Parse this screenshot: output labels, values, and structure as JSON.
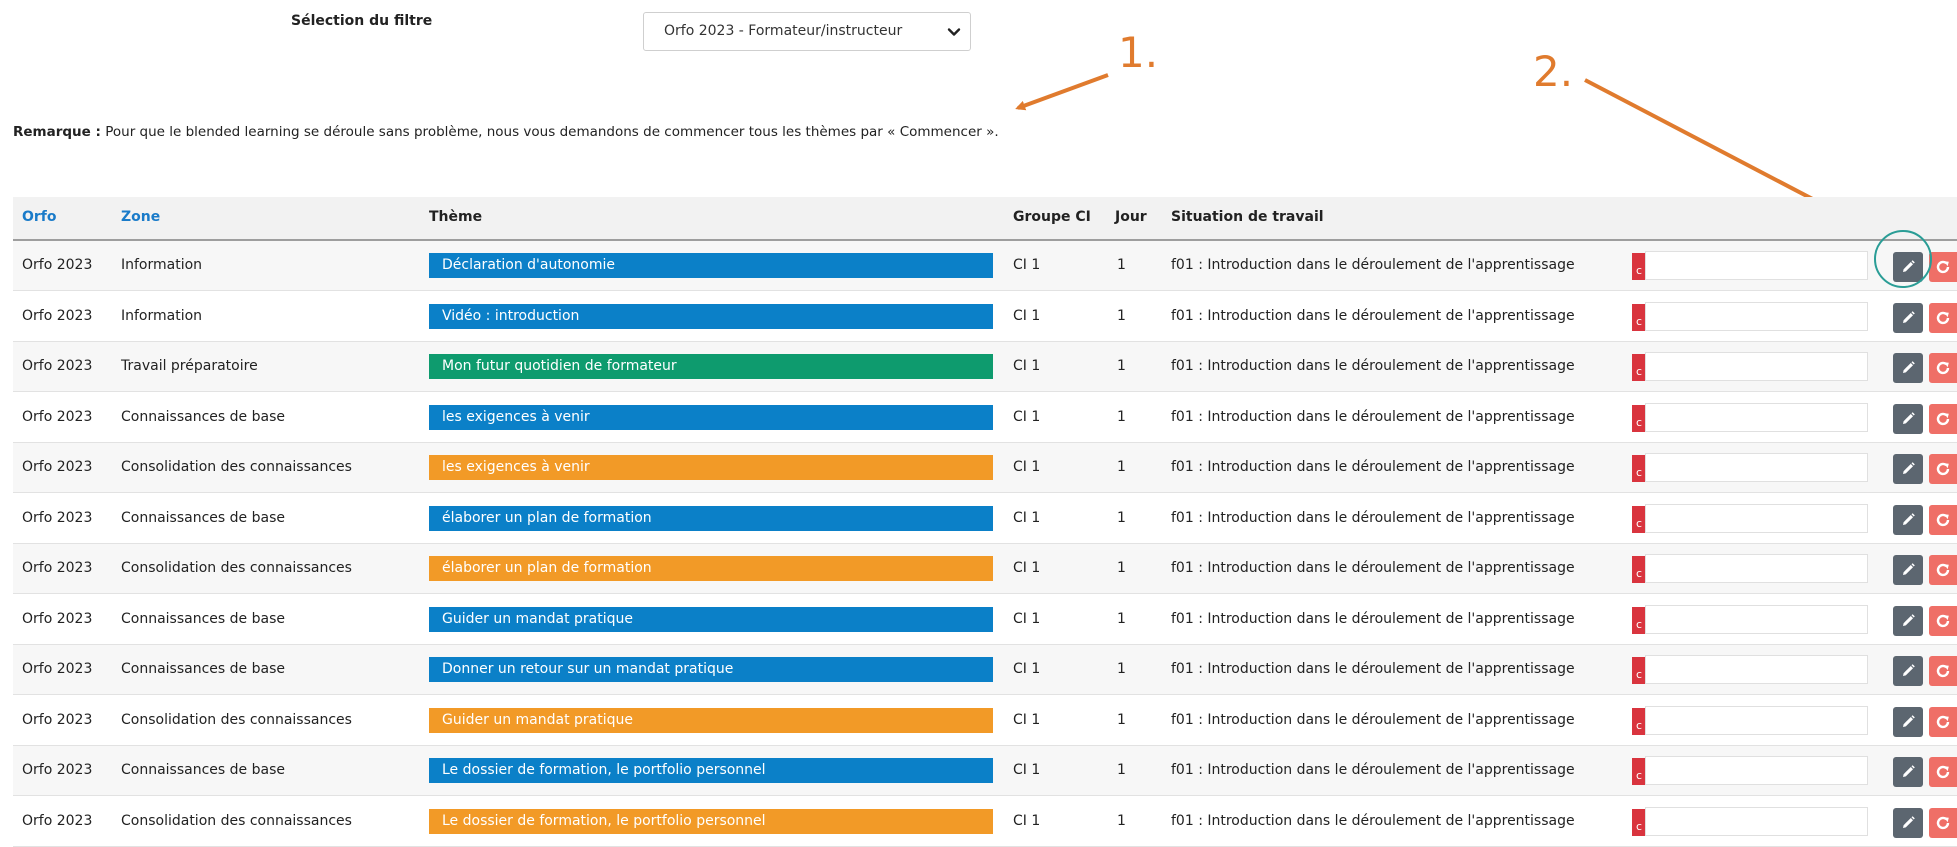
{
  "filter": {
    "label": "Sélection du filtre",
    "selected": "Orfo 2023 - Formateur/instructeur"
  },
  "annotations": {
    "one": "1.",
    "two": "2."
  },
  "remark": {
    "bold": "Remarque :",
    "text": " Pour que le blended learning se déroule sans problème, nous vous demandons de commencer tous les thèmes par « Commencer »."
  },
  "table": {
    "headers": {
      "orfo": "Orfo",
      "zone": "Zone",
      "theme": "Thème",
      "groupe": "Groupe CI",
      "jour": "Jour",
      "situation": "Situation de travail"
    },
    "rows": [
      {
        "orfo": "Orfo 2023",
        "zone": "Information",
        "theme": "Déclaration d'autonomie",
        "color": "#0b80c8",
        "groupe": "CI 1",
        "jour": "1",
        "situation": "f01 : Introduction dans le déroulement de l'apprentissage",
        "strip": "c"
      },
      {
        "orfo": "Orfo 2023",
        "zone": "Information",
        "theme": "Vidéo : introduction",
        "color": "#0b80c8",
        "groupe": "CI 1",
        "jour": "1",
        "situation": "f01 : Introduction dans le déroulement de l'apprentissage",
        "strip": "c"
      },
      {
        "orfo": "Orfo 2023",
        "zone": "Travail préparatoire",
        "theme": "Mon futur quotidien de formateur",
        "color": "#0e9b6e",
        "groupe": "CI 1",
        "jour": "1",
        "situation": "f01 : Introduction dans le déroulement de l'apprentissage",
        "strip": "c"
      },
      {
        "orfo": "Orfo 2023",
        "zone": "Connaissances de base",
        "theme": "les exigences à venir",
        "color": "#0b80c8",
        "groupe": "CI 1",
        "jour": "1",
        "situation": "f01 : Introduction dans le déroulement de l'apprentissage",
        "strip": "c"
      },
      {
        "orfo": "Orfo 2023",
        "zone": "Consolidation des connaissances",
        "theme": "les exigences à venir",
        "color": "#f29a27",
        "groupe": "CI 1",
        "jour": "1",
        "situation": "f01 : Introduction dans le déroulement de l'apprentissage",
        "strip": "c"
      },
      {
        "orfo": "Orfo 2023",
        "zone": "Connaissances de base",
        "theme": "élaborer un plan de formation",
        "color": "#0b80c8",
        "groupe": "CI 1",
        "jour": "1",
        "situation": "f01 : Introduction dans le déroulement de l'apprentissage",
        "strip": "c"
      },
      {
        "orfo": "Orfo 2023",
        "zone": "Consolidation des connaissances",
        "theme": "élaborer un plan de formation",
        "color": "#f29a27",
        "groupe": "CI 1",
        "jour": "1",
        "situation": "f01 : Introduction dans le déroulement de l'apprentissage",
        "strip": "c"
      },
      {
        "orfo": "Orfo 2023",
        "zone": "Connaissances de base",
        "theme": "Guider un mandat pratique",
        "color": "#0b80c8",
        "groupe": "CI 1",
        "jour": "1",
        "situation": "f01 : Introduction dans le déroulement de l'apprentissage",
        "strip": "c"
      },
      {
        "orfo": "Orfo 2023",
        "zone": "Connaissances de base",
        "theme": "Donner un retour sur un mandat pratique",
        "color": "#0b80c8",
        "groupe": "CI 1",
        "jour": "1",
        "situation": "f01 : Introduction dans le déroulement de l'apprentissage",
        "strip": "c"
      },
      {
        "orfo": "Orfo 2023",
        "zone": "Consolidation des connaissances",
        "theme": "Guider un mandat pratique",
        "color": "#f29a27",
        "groupe": "CI 1",
        "jour": "1",
        "situation": "f01 : Introduction dans le déroulement de l'apprentissage",
        "strip": "c"
      },
      {
        "orfo": "Orfo 2023",
        "zone": "Connaissances de base",
        "theme": "Le dossier de formation, le portfolio personnel",
        "color": "#0b80c8",
        "groupe": "CI 1",
        "jour": "1",
        "situation": "f01 : Introduction dans le déroulement de l'apprentissage",
        "strip": "c"
      },
      {
        "orfo": "Orfo 2023",
        "zone": "Consolidation des connaissances",
        "theme": "Le dossier de formation, le portfolio personnel",
        "color": "#f29a27",
        "groupe": "CI 1",
        "jour": "1",
        "situation": "f01 : Introduction dans le déroulement de l'apprentissage",
        "strip": "c"
      }
    ]
  },
  "icons": {
    "edit": "pencil-icon",
    "reset": "refresh-icon",
    "dropdown": "chevron-down-icon"
  },
  "colors": {
    "link": "#1a7bc9",
    "annotation": "#e07b2e",
    "highlight": "#2a9d96",
    "edit_button": "#5c6670",
    "reset_button": "#ef6f67",
    "status_strip": "#d9343e"
  }
}
